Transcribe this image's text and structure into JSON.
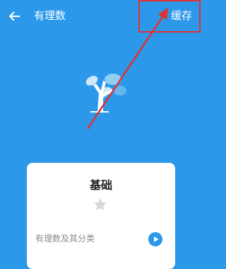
{
  "header": {
    "back_icon": "arrow-left-icon",
    "title": "有理数",
    "cache_label": "缓存"
  },
  "card": {
    "title": "基础",
    "star_icon": "star-icon",
    "lesson": {
      "label": "有理数及其分类",
      "play_icon": "play-icon"
    }
  },
  "colors": {
    "background": "#2b98ea",
    "annotation": "#e53030",
    "play": "#2b98ea"
  }
}
